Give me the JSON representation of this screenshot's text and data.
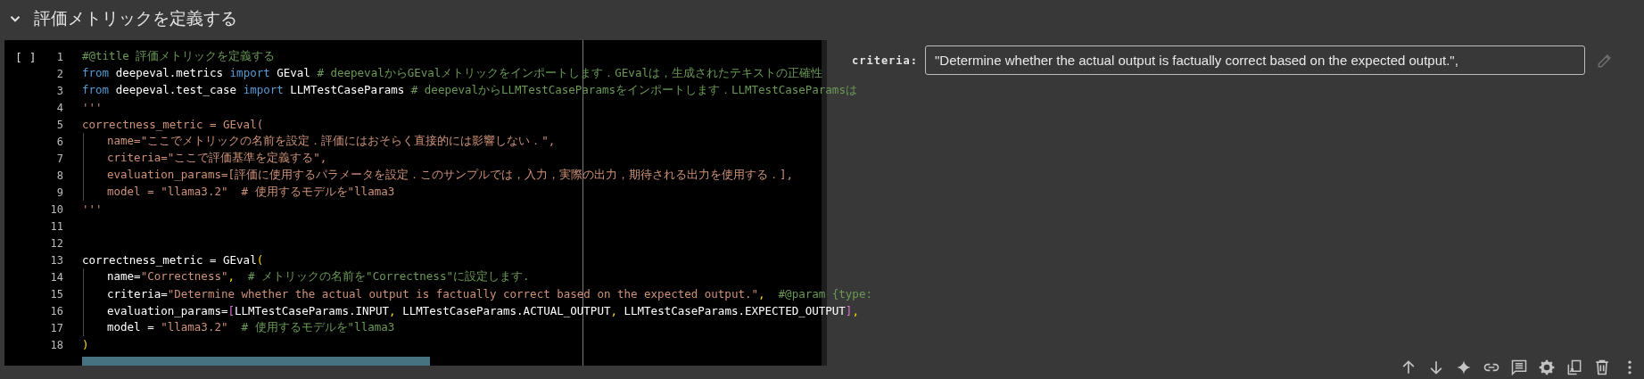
{
  "section": {
    "title": "評価メトリックを定義する",
    "expanded": true
  },
  "cell": {
    "run_marker": "[ ]",
    "lines": [
      {
        "number": "1",
        "tokens": [
          {
            "kind": "comment",
            "text": "#@title 評価メトリックを定義する"
          }
        ]
      },
      {
        "number": "2",
        "tokens": [
          {
            "kind": "keyword",
            "text": "from"
          },
          {
            "kind": "plain",
            "text": " deepeval.metrics "
          },
          {
            "kind": "keyword",
            "text": "import"
          },
          {
            "kind": "plain",
            "text": " GEval "
          },
          {
            "kind": "comment",
            "text": "# deepevalからGEvalメトリックをインポートします．GEvalは，生成されたテキストの正確性"
          }
        ]
      },
      {
        "number": "3",
        "tokens": [
          {
            "kind": "keyword",
            "text": "from"
          },
          {
            "kind": "plain",
            "text": " deepeval.test_case "
          },
          {
            "kind": "keyword",
            "text": "import"
          },
          {
            "kind": "plain",
            "text": " LLMTestCaseParams "
          },
          {
            "kind": "comment",
            "text": "# deepevalからLLMTestCaseParamsをインポートします．LLMTestCaseParamsは"
          }
        ]
      },
      {
        "number": "4",
        "tokens": [
          {
            "kind": "string",
            "text": "'''"
          }
        ]
      },
      {
        "number": "5",
        "tokens": [
          {
            "kind": "string",
            "text": "correctness_metric = GEval("
          }
        ]
      },
      {
        "number": "6",
        "indent_guide": true,
        "tokens": [
          {
            "kind": "string",
            "text": "name=\"ここでメトリックの名前を設定．評価にはおそらく直接的には影響しない．\","
          }
        ]
      },
      {
        "number": "7",
        "indent_guide": true,
        "tokens": [
          {
            "kind": "string",
            "text": "criteria=\"ここで評価基準を定義する\","
          }
        ]
      },
      {
        "number": "8",
        "indent_guide": true,
        "tokens": [
          {
            "kind": "string",
            "text": "evaluation_params=[評価に使用するパラメータを設定．このサンプルでは，入力，実際の出力，期待される出力を使用する．],"
          }
        ]
      },
      {
        "number": "9",
        "indent_guide": true,
        "tokens": [
          {
            "kind": "string",
            "text": "model = \"llama3.2\"  # 使用するモデルを\"llama3"
          }
        ]
      },
      {
        "number": "10",
        "tokens": [
          {
            "kind": "string",
            "text": "'''"
          }
        ]
      },
      {
        "number": "11"
      },
      {
        "number": "12"
      },
      {
        "number": "13",
        "tokens": [
          {
            "kind": "plain",
            "text": "correctness_metric = GEval"
          },
          {
            "kind": "paren",
            "text": "("
          }
        ]
      },
      {
        "number": "14",
        "indent_guide": true,
        "tokens": [
          {
            "kind": "plain",
            "text": "name="
          },
          {
            "kind": "string",
            "text": "\"Correctness\""
          },
          {
            "kind": "paren",
            "text": ","
          },
          {
            "kind": "comment",
            "text": "  # メトリックの名前を\"Correctness\"に設定します."
          }
        ]
      },
      {
        "number": "15",
        "indent_guide": true,
        "tokens": [
          {
            "kind": "plain",
            "text": "criteria="
          },
          {
            "kind": "string",
            "text": "\"Determine whether the actual output is factually correct based on the expected output.\""
          },
          {
            "kind": "paren",
            "text": ","
          },
          {
            "kind": "comment",
            "text": "  #@param {type:"
          }
        ]
      },
      {
        "number": "16",
        "indent_guide": true,
        "tokens": [
          {
            "kind": "plain",
            "text": "evaluation_params="
          },
          {
            "kind": "bracket",
            "text": "["
          },
          {
            "kind": "plain",
            "text": "LLMTestCaseParams.INPUT"
          },
          {
            "kind": "paren",
            "text": ","
          },
          {
            "kind": "plain",
            "text": " LLMTestCaseParams.ACTUAL_OUTPUT"
          },
          {
            "kind": "paren",
            "text": ","
          },
          {
            "kind": "plain",
            "text": " LLMTestCaseParams.EXPECTED_OUTPUT"
          },
          {
            "kind": "bracket",
            "text": "]"
          },
          {
            "kind": "paren",
            "text": ","
          }
        ]
      },
      {
        "number": "17",
        "indent_guide": true,
        "tokens": [
          {
            "kind": "plain",
            "text": "model = "
          },
          {
            "kind": "string",
            "text": "\"llama3.2\""
          },
          {
            "kind": "comment",
            "text": "  # 使用するモデルを\"llama3"
          }
        ]
      },
      {
        "number": "18",
        "tokens": [
          {
            "kind": "paren",
            "text": ")"
          }
        ]
      }
    ]
  },
  "form": {
    "label": "criteria:",
    "value": "\"Determine whether the actual output is factually correct based on the expected output.\","
  },
  "toolbar": [
    {
      "kind": "up"
    },
    {
      "kind": "down"
    },
    {
      "kind": "sparkle"
    },
    {
      "kind": "link"
    },
    {
      "kind": "comment"
    },
    {
      "kind": "settings"
    },
    {
      "kind": "mirror"
    },
    {
      "kind": "delete"
    },
    {
      "kind": "more"
    }
  ]
}
